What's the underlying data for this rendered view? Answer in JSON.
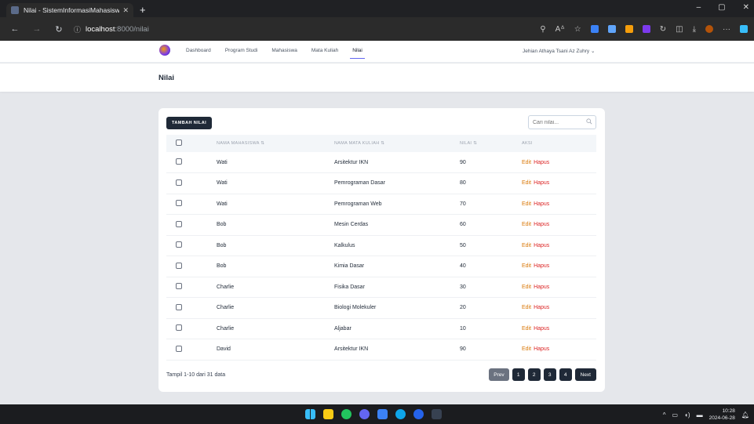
{
  "browser": {
    "tab_title": "Nilai - SistemInformasiMahasisw",
    "url_host": "localhost",
    "url_path": ":8000/nilai"
  },
  "nav": {
    "items": [
      "Dashboard",
      "Program Studi",
      "Mahasiswa",
      "Mata Kuliah",
      "Nilai"
    ],
    "active": "Nilai",
    "user": "Jehian Athaya Tsani Az Zuhry"
  },
  "page": {
    "title": "Nilai"
  },
  "toolbar": {
    "add_label": "TAMBAH NILAI",
    "search_placeholder": "Cari nilai..."
  },
  "table": {
    "headers": {
      "mahasiswa": "NAMA MAHASISWA ⇅",
      "matkul": "NAMA MATA KULIAH ⇅",
      "nilai": "NILAI ⇅",
      "aksi": "AKSI"
    },
    "rows": [
      {
        "mahasiswa": "Wati",
        "matkul": "Arsitektur IKN",
        "nilai": "90"
      },
      {
        "mahasiswa": "Wati",
        "matkul": "Pemrograman Dasar",
        "nilai": "80"
      },
      {
        "mahasiswa": "Wati",
        "matkul": "Pemrograman Web",
        "nilai": "70"
      },
      {
        "mahasiswa": "Bob",
        "matkul": "Mesin Cerdas",
        "nilai": "60"
      },
      {
        "mahasiswa": "Bob",
        "matkul": "Kalkulus",
        "nilai": "50"
      },
      {
        "mahasiswa": "Bob",
        "matkul": "Kimia Dasar",
        "nilai": "40"
      },
      {
        "mahasiswa": "Charlie",
        "matkul": "Fisika Dasar",
        "nilai": "30"
      },
      {
        "mahasiswa": "Charlie",
        "matkul": "Biologi Molekuler",
        "nilai": "20"
      },
      {
        "mahasiswa": "Charlie",
        "matkul": "Aljabar",
        "nilai": "10"
      },
      {
        "mahasiswa": "David",
        "matkul": "Arsitektur IKN",
        "nilai": "90"
      }
    ],
    "edit_label": "Edit",
    "delete_label": "Hapus"
  },
  "footer": {
    "count_text": "Tampil 1-10 dari 31 data"
  },
  "pagination": {
    "prev": "Prev",
    "pages": [
      "1",
      "2",
      "3",
      "4"
    ],
    "next": "Next"
  },
  "taskbar": {
    "time": "10:28",
    "date": "2024-06-28"
  },
  "colors": {
    "primary_dark": "#1f2937",
    "edit": "#d97706",
    "delete": "#dc2626"
  }
}
